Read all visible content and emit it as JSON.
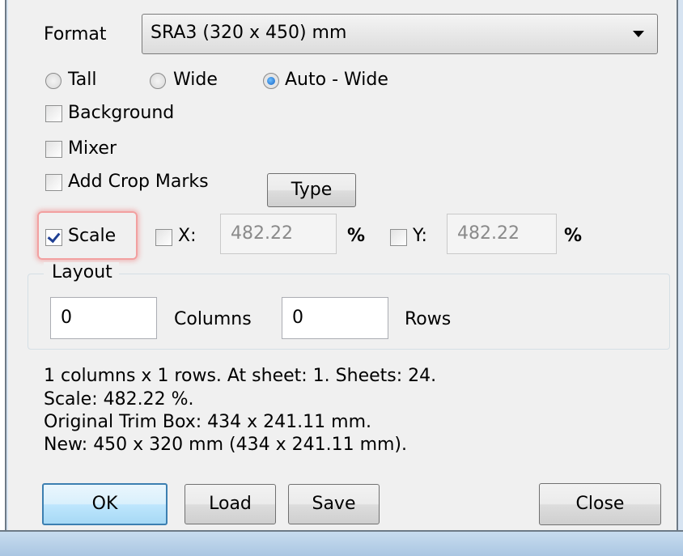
{
  "format": {
    "label": "Format",
    "selected": "SRA3 (320 x 450) mm"
  },
  "orientation": {
    "options": [
      {
        "label": "Tall",
        "checked": false
      },
      {
        "label": "Wide",
        "checked": false
      },
      {
        "label": "Auto - Wide",
        "checked": true
      }
    ]
  },
  "options": {
    "background": {
      "label": "Background",
      "checked": false
    },
    "mixer": {
      "label": "Mixer",
      "checked": false
    },
    "crop_marks": {
      "label": "Add Crop Marks",
      "checked": false
    },
    "type_button": "Type"
  },
  "scale": {
    "label": "Scale",
    "checked": true,
    "x_label": "X:",
    "x_value": "482.22",
    "x_checked": false,
    "y_label": "Y:",
    "y_value": "482.22",
    "y_checked": false,
    "unit": "%"
  },
  "layout": {
    "title": "Layout",
    "columns_value": "0",
    "columns_label": "Columns",
    "rows_value": "0",
    "rows_label": "Rows"
  },
  "info": {
    "line1": "1 columns x 1 rows. At sheet: 1. Sheets: 24.",
    "line2": "Scale: 482.22 %.",
    "line3": "Original Trim Box: 434 x 241.11 mm.",
    "line4": "New: 450 x 320 mm (434 x 241.11 mm)."
  },
  "buttons": {
    "ok": "OK",
    "load": "Load",
    "save": "Save",
    "close": "Close"
  }
}
